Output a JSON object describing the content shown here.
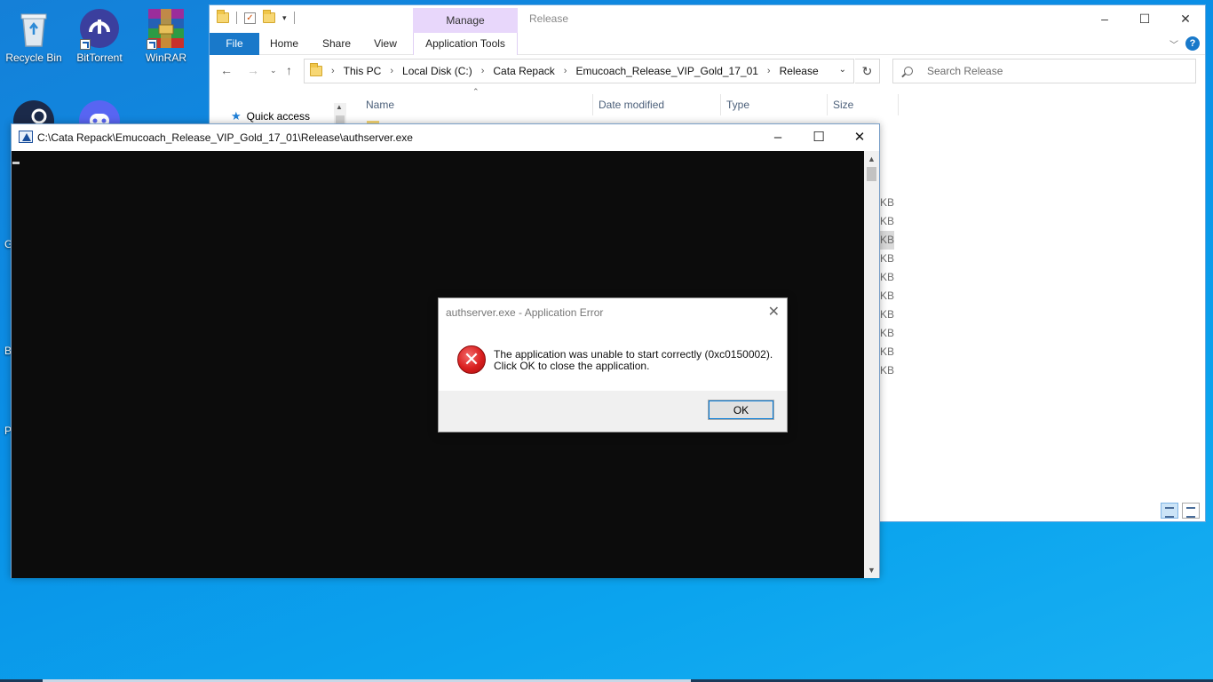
{
  "desktop": {
    "icons": [
      {
        "label": "Recycle Bin"
      },
      {
        "label": "BitTorrent"
      },
      {
        "label": "WinRAR"
      }
    ],
    "partial_letters": [
      "G",
      "B",
      "P"
    ]
  },
  "explorer": {
    "title": "Release",
    "manage_tab": "Manage",
    "ribbon_tabs": [
      "File",
      "Home",
      "Share",
      "View",
      "Application Tools"
    ],
    "breadcrumb": [
      "This PC",
      "Local Disk (C:)",
      "Cata Repack",
      "Emucoach_Release_VIP_Gold_17_01",
      "Release"
    ],
    "search_placeholder": "Search Release",
    "nav": {
      "quick_access": "Quick access"
    },
    "columns": [
      "Name",
      "Date modified",
      "Type",
      "Size"
    ],
    "size_units": [
      "KB",
      "KB",
      "KB",
      "KB",
      "KB",
      "KB",
      "KB",
      "KB",
      "KB",
      "KB"
    ],
    "window_controls": {
      "minimize": "–",
      "maximize": "☐",
      "close": "✕"
    }
  },
  "console": {
    "title": "C:\\Cata Repack\\Emucoach_Release_VIP_Gold_17_01\\Release\\authserver.exe",
    "window_controls": {
      "minimize": "–",
      "maximize": "☐",
      "close": "✕"
    }
  },
  "dialog": {
    "title": "authserver.exe - Application Error",
    "message_line1": "The application was unable to start correctly (0xc0150002).",
    "message_line2": "Click OK to close the application.",
    "ok_label": "OK",
    "icon": "error-icon",
    "icon_glyph": "✕"
  }
}
